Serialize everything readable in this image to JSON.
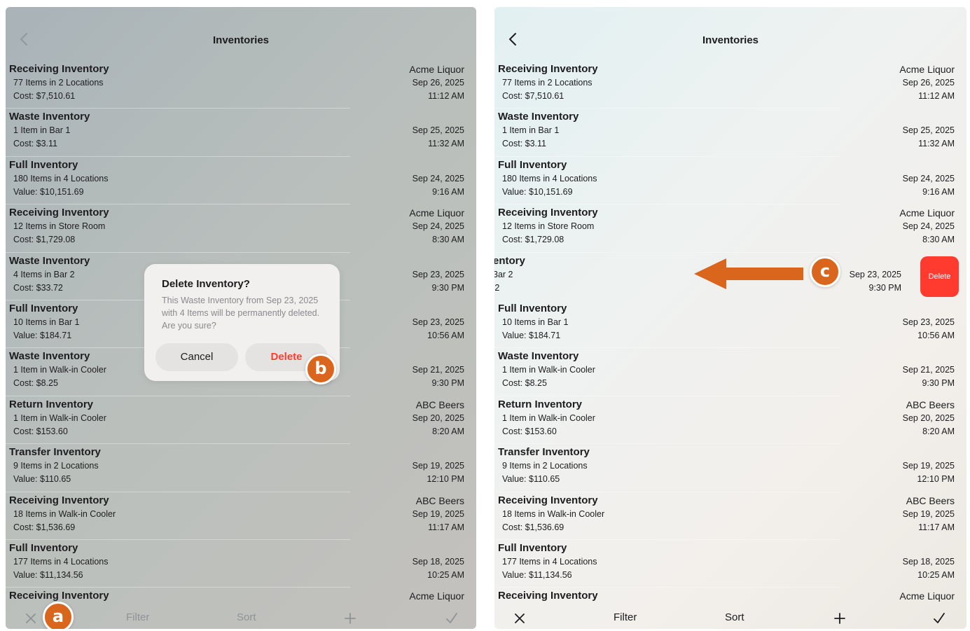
{
  "nav": {
    "title": "Inventories"
  },
  "rows": [
    {
      "title": "Receiving Inventory",
      "sub": "77 Items in 2 Locations",
      "cost": "Cost: $7,510.61",
      "vendor": "Acme Liquor",
      "date": "Sep 26, 2025",
      "time": "11:12 AM"
    },
    {
      "title": "Waste Inventory",
      "sub": "1 Item in Bar 1",
      "cost": "Cost: $3.11",
      "vendor": "",
      "date": "Sep 25, 2025",
      "time": "11:32 AM"
    },
    {
      "title": "Full Inventory",
      "sub": "180 Items in 4 Locations",
      "cost": "Value: $10,151.69",
      "vendor": "",
      "date": "Sep 24, 2025",
      "time": "9:16 AM"
    },
    {
      "title": "Receiving Inventory",
      "sub": "12 Items in Store Room",
      "cost": "Cost: $1,729.08",
      "vendor": "Acme Liquor",
      "date": "Sep 24, 2025",
      "time": "8:30 AM"
    },
    {
      "title": "Waste Inventory",
      "sub": "4 Items in Bar 2",
      "cost": "Cost: $33.72",
      "vendor": "",
      "date": "Sep 23, 2025",
      "time": "9:30 PM"
    },
    {
      "title": "Full Inventory",
      "sub": "10 Items in Bar 1",
      "cost": "Value: $184.71",
      "vendor": "",
      "date": "Sep 23, 2025",
      "time": "10:56 AM"
    },
    {
      "title": "Waste Inventory",
      "sub": "1 Item in Walk-in Cooler",
      "cost": "Cost: $8.25",
      "vendor": "",
      "date": "Sep 21, 2025",
      "time": "9:30 PM"
    },
    {
      "title": "Return Inventory",
      "sub": "1 Item in Walk-in Cooler",
      "cost": "Cost: $153.60",
      "vendor": "ABC Beers",
      "date": "Sep 20, 2025",
      "time": "8:20 AM"
    },
    {
      "title": "Transfer Inventory",
      "sub": "9 Items in 2 Locations",
      "cost": "Value: $110.65",
      "vendor": "",
      "date": "Sep 19, 2025",
      "time": "12:10 PM"
    },
    {
      "title": "Receiving Inventory",
      "sub": "18 Items in Walk-in Cooler",
      "cost": "Cost: $1,536.69",
      "vendor": "ABC Beers",
      "date": "Sep 19, 2025",
      "time": "11:17 AM"
    },
    {
      "title": "Full Inventory",
      "sub": "177 Items in 4 Locations",
      "cost": "Value: $11,134.56",
      "vendor": "",
      "date": "Sep 18, 2025",
      "time": "10:25 AM"
    },
    {
      "title": "Receiving Inventory",
      "sub": "",
      "cost": "",
      "vendor": "Acme Liquor",
      "date": "",
      "time": ""
    }
  ],
  "toolbar": {
    "filter_label": "Filter",
    "sort_label": "Sort"
  },
  "dialog": {
    "title": "Delete Inventory?",
    "message": "This Waste Inventory from Sep 23, 2025 with 4 Items will be permanently deleted.  Are you sure?",
    "cancel_label": "Cancel",
    "delete_label": "Delete"
  },
  "swipe_row": {
    "title_fragment": "entory",
    "sub_fragment": "3ar 2",
    "cost_fragment": "'2",
    "date": "Sep 23, 2025",
    "time": "9:30 PM",
    "delete_label": "Delete"
  },
  "callouts": {
    "a": "a",
    "b": "b",
    "c": "c"
  },
  "colors": {
    "accent_orange": "#d9661c",
    "destructive_red": "#ff3b30"
  },
  "icons": [
    "chevron-left-icon",
    "close-icon",
    "plus-icon",
    "checkmark-icon",
    "arrow-left-icon"
  ]
}
